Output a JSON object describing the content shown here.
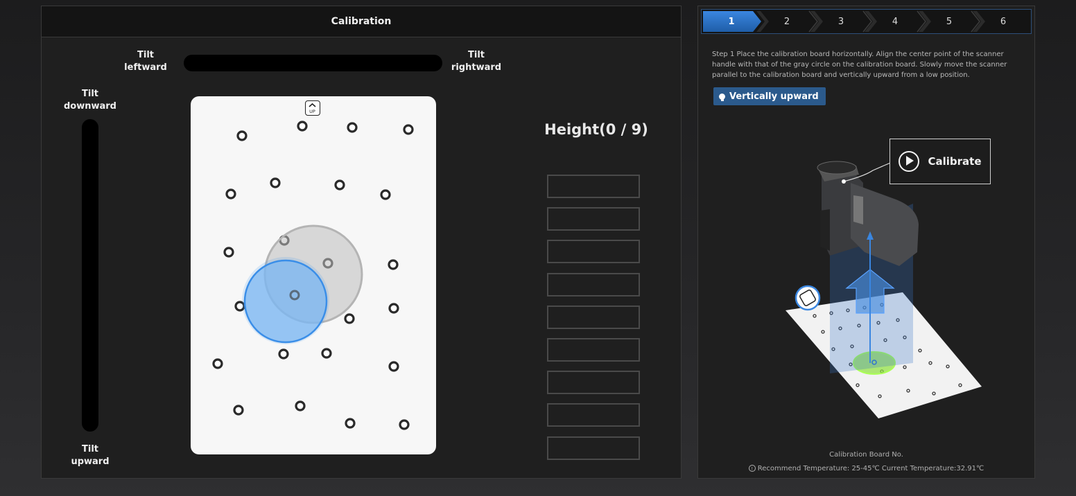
{
  "left": {
    "title": "Calibration",
    "tilt_left": [
      "Tilt",
      "leftward"
    ],
    "tilt_right": [
      "Tilt",
      "rightward"
    ],
    "tilt_down": [
      "Tilt",
      "downward"
    ],
    "tilt_up": [
      "Tilt",
      "upward"
    ],
    "board_badge": "UP",
    "height_label": "Height(0 / 9)",
    "height_slots_filled": 0,
    "height_slots_total": 9
  },
  "right": {
    "steps": [
      {
        "label": "1",
        "active": true
      },
      {
        "label": "2",
        "active": false
      },
      {
        "label": "3",
        "active": false
      },
      {
        "label": "4",
        "active": false
      },
      {
        "label": "5",
        "active": false
      },
      {
        "label": "6",
        "active": false
      }
    ],
    "instructions": "Step 1 Place the calibration board horizontally. Align the center point of the scanner handle with that of the gray circle on the calibration board. Slowly move the scanner parallel to the calibration board and vertically upward from a low position.",
    "tip": "Vertically upward",
    "calibrate_label": "Calibrate",
    "board_no_label": "Calibration Board No.",
    "temperature_text": "Recommend Temperature: 25-45℃ Current Temperature:32.91℃"
  },
  "colors": {
    "accent_blue": "#2b6fc4",
    "target_gray": "#c8c8c8",
    "green_highlight": "#7ee23a"
  },
  "icons": [
    "up-icon",
    "lightbulb-icon",
    "play-icon",
    "info-icon"
  ]
}
